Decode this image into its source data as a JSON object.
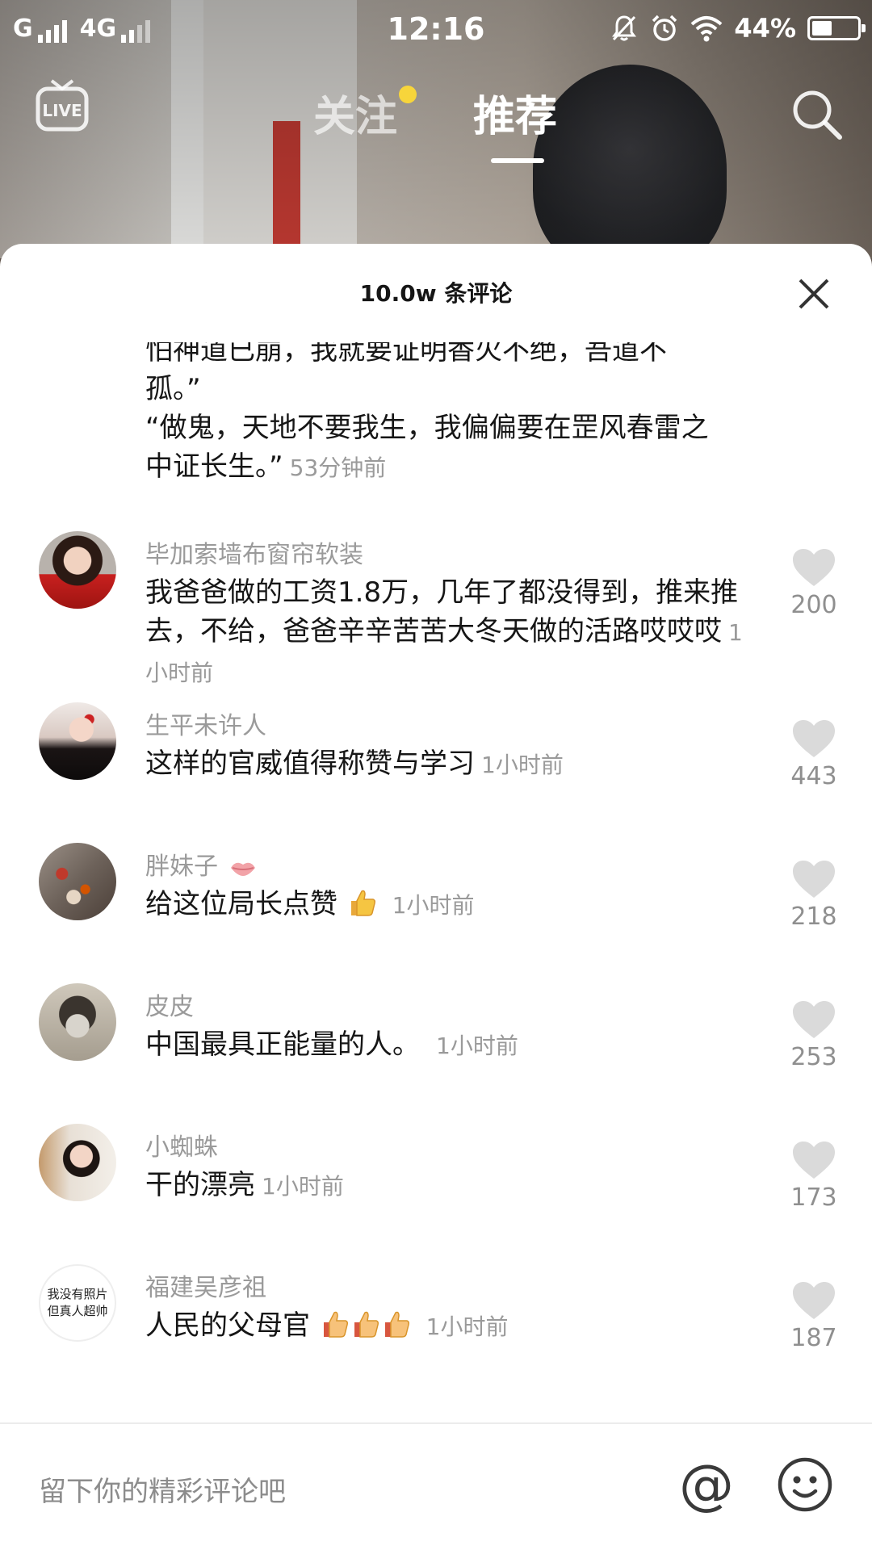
{
  "status_bar": {
    "carrier_1": "G",
    "carrier_2": "4G",
    "time": "12:16",
    "battery": "44%",
    "battery_level": 0.44
  },
  "nav": {
    "tab_follow": "关注",
    "tab_recommend": "推荐",
    "active_tab": "推荐"
  },
  "sheet": {
    "title": "10.0w 条评论"
  },
  "partial_comment": {
    "lines": [
      "怕神道已崩，我就要证明香火不绝，吾道不",
      "孤。”",
      "“做鬼，天地不要我生，我偏偏要在罡风春雷之",
      "中证长生。”"
    ],
    "time": "53分钟前"
  },
  "comments": [
    {
      "name": "毕加索墙布窗帘软装",
      "text": "我爸爸做的工资1.8万，几年了都没得到，推来推去，不给，爸爸辛辛苦苦大冬天做的活路哎哎哎",
      "time": "1小时前",
      "likes": "200"
    },
    {
      "name": "生平未许人",
      "text": "这样的官威值得称赞与学习",
      "time": "1小时前",
      "likes": "443"
    },
    {
      "name": "胖妹子",
      "text": "给这位局长点赞",
      "time": "1小时前",
      "likes": "218"
    },
    {
      "name": "皮皮",
      "text": "中国最具正能量的人。",
      "time": "1小时前",
      "likes": "253"
    },
    {
      "name": "小蜘蛛",
      "text": "干的漂亮",
      "time": "1小时前",
      "likes": "173"
    },
    {
      "name": "福建吴彦祖",
      "text": "人民的父母官",
      "time": "1小时前",
      "likes": "187",
      "avatar_text_1": "我没有照片",
      "avatar_text_2": "但真人超帅"
    }
  ],
  "input": {
    "placeholder": "留下你的精彩评论吧"
  },
  "colors": {
    "sheet_bg": "#ffffff",
    "muted_text": "#9a9a9a",
    "like_heart": "#dadada",
    "badge_dot": "#f7d53b"
  },
  "icons": [
    "live-icon",
    "search-icon",
    "close-icon",
    "heart-icon",
    "at-icon",
    "smile-icon",
    "thumbs-up-icon",
    "lips-icon"
  ]
}
